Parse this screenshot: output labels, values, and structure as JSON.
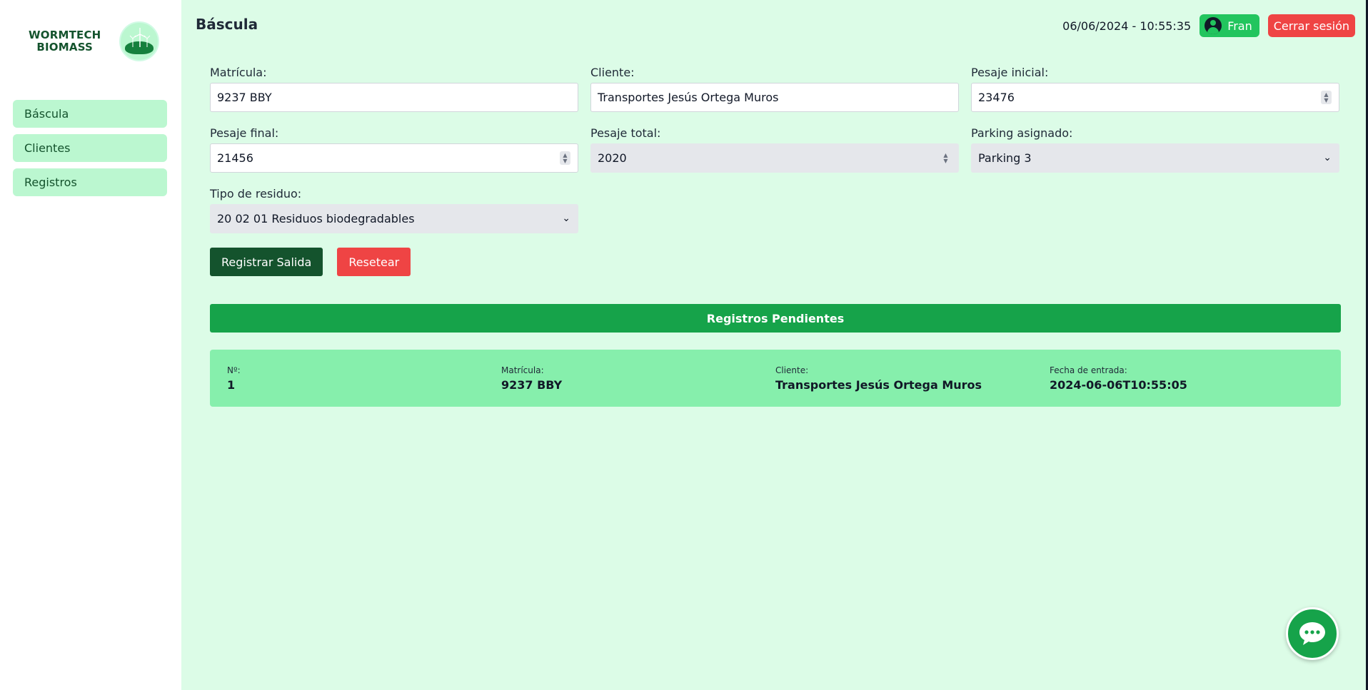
{
  "brand": {
    "line1": "WORMTECH",
    "line2": "BIOMASS",
    "logo_icon": "wind-turbine-globe-icon"
  },
  "sidebar": {
    "items": [
      {
        "label": "Báscula"
      },
      {
        "label": "Clientes"
      },
      {
        "label": "Registros"
      }
    ]
  },
  "header": {
    "title": "Báscula",
    "datetime": "06/06/2024 - 10:55:35",
    "user": "Fran",
    "logout_label": "Cerrar sesión"
  },
  "form": {
    "matricula": {
      "label": "Matrícula:",
      "value": "9237 BBY"
    },
    "cliente": {
      "label": "Cliente:",
      "value": "Transportes Jesús Ortega Muros"
    },
    "pesaje_inicial": {
      "label": "Pesaje inicial:",
      "value": "23476"
    },
    "pesaje_final": {
      "label": "Pesaje final:",
      "value": "21456"
    },
    "pesaje_total": {
      "label": "Pesaje total:",
      "value": "2020"
    },
    "parking": {
      "label": "Parking asignado:",
      "value": "Parking 3"
    },
    "tipo_residuo": {
      "label": "Tipo de residuo:",
      "value": "20 02 01 Residuos biodegradables"
    },
    "submit_label": "Registrar Salida",
    "reset_label": "Resetear"
  },
  "pending": {
    "title": "Registros Pendientes",
    "records": [
      {
        "num_label": "Nº:",
        "num": "1",
        "matricula_label": "Matrícula:",
        "matricula": "9237 BBY",
        "cliente_label": "Cliente:",
        "cliente": "Transportes Jesús Ortega Muros",
        "fecha_label": "Fecha de entrada:",
        "fecha": "2024-06-06T10:55:05"
      }
    ]
  },
  "colors": {
    "background": "#dcfce7",
    "accent": "#16a34a",
    "primary_dark": "#14532d",
    "danger": "#ef4444",
    "card": "#86efac"
  },
  "chat": {
    "icon": "chat-bubble-icon"
  }
}
